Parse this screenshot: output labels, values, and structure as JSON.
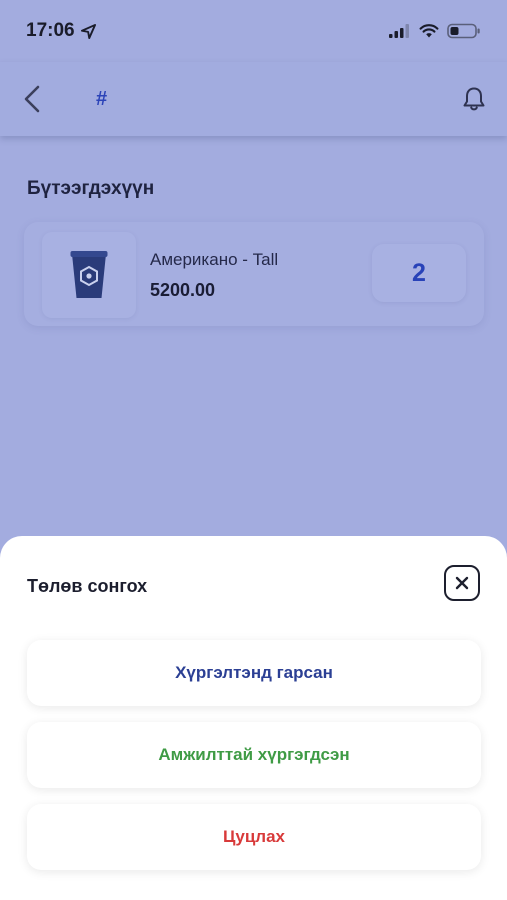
{
  "status_bar": {
    "time": "17:06"
  },
  "header": {
    "title": "#"
  },
  "products": {
    "section_title": "Бүтээгдэхүүн",
    "item": {
      "name": "Американо - Tall",
      "price": "5200.00",
      "quantity": "2"
    }
  },
  "sheet": {
    "title": "Төлөв сонгох",
    "options": [
      {
        "label": "Хүргэлтэнд гарсан",
        "color": "#2b3f94"
      },
      {
        "label": "Амжилттай хүргэгдсэн",
        "color": "#3f9b45"
      },
      {
        "label": "Цуцлах",
        "color": "#d83a3a"
      }
    ]
  },
  "colors": {
    "background": "#a3acdf",
    "accent": "#2842b8",
    "cup": "#2a3b7a"
  },
  "icons": {
    "location": "location-arrow-icon",
    "signal": "cellular-signal-icon",
    "wifi": "wifi-icon",
    "battery": "battery-icon",
    "back": "chevron-left-icon",
    "bell": "bell-icon",
    "close": "close-icon",
    "product": "coffee-cup-icon"
  }
}
